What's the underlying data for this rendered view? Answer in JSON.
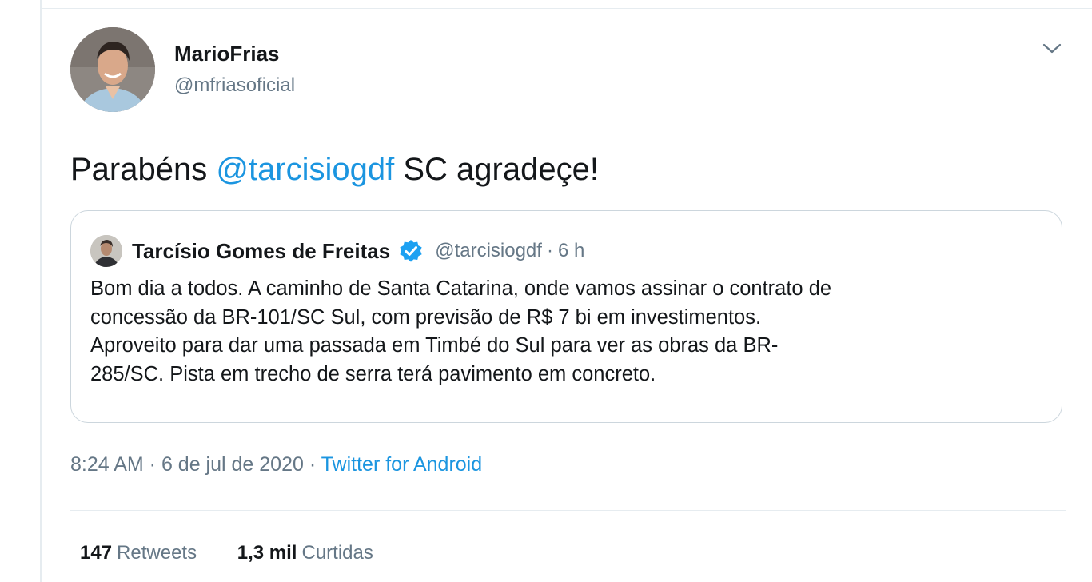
{
  "author": {
    "name": "MarioFrias",
    "handle": "@mfriasoficial"
  },
  "tweet": {
    "text_before": "Parabéns ",
    "mention": "@tarcisiogdf",
    "text_after": " SC agradeçe!"
  },
  "quote": {
    "name": "Tarcísio Gomes de Freitas",
    "handle": "@tarcisiogdf",
    "separator": "·",
    "time": "6 h",
    "lines": [
      "Bom dia a todos. A caminho de Santa Catarina, onde vamos assinar o contrato de",
      "concessão da BR-101/SC Sul, com previsão de R$ 7 bi em investimentos.",
      "Aproveito para dar uma passada em Timbé do Sul para ver as obras da BR-",
      "285/SC. Pista em trecho de serra terá pavimento em concreto."
    ]
  },
  "meta": {
    "timestamp": "8:24 AM · 6 de jul de 2020",
    "separator": "·",
    "source": "Twitter for Android"
  },
  "stats": {
    "retweets_count": "147",
    "retweets_label": "Retweets",
    "likes_count": "1,3 mil",
    "likes_label": "Curtidas"
  },
  "colors": {
    "link": "#1b95e0",
    "secondary_text": "#657786",
    "verified": "#1da1f2",
    "border": "#ccd6dd"
  }
}
